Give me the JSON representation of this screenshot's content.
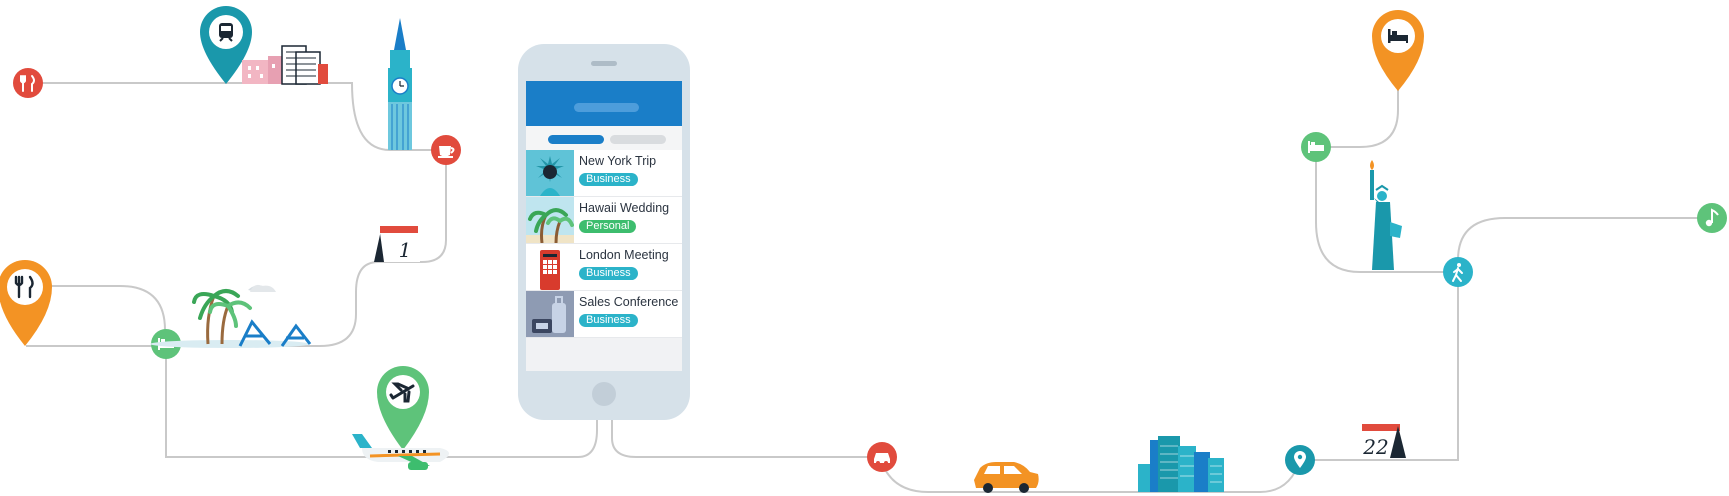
{
  "trips": [
    {
      "title": "New York Trip",
      "tag": "Business",
      "tag_type": "business",
      "thumb": "statue-of-liberty"
    },
    {
      "title": "Hawaii Wedding",
      "tag": "Personal",
      "tag_type": "personal",
      "thumb": "palm-trees"
    },
    {
      "title": "London Meeting",
      "tag": "Business",
      "tag_type": "business",
      "thumb": "phone-booth"
    },
    {
      "title": "Sales Conference",
      "tag": "Business",
      "tag_type": "business",
      "thumb": "luggage"
    }
  ],
  "calendar_left_day": "1",
  "calendar_right_day": "22",
  "colors": {
    "route": "#c8c8c8",
    "red": "#e14b3d",
    "orange": "#f39324",
    "green": "#3dbd6e",
    "teal": "#1a98ab",
    "blue": "#1a7ec8",
    "cyan": "#2bb3c9",
    "phone": "#d6e1e9"
  }
}
